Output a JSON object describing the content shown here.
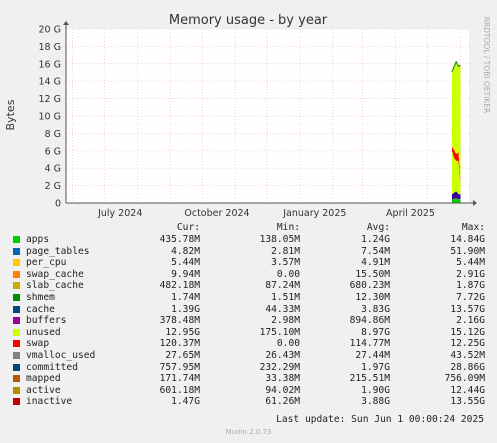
{
  "chart_data": {
    "type": "area",
    "title": "Memory usage - by year",
    "ylabel": "Bytes",
    "xlabel": "",
    "ylim": [
      0,
      20
    ],
    "y_unit": "G",
    "y_ticks": [
      "0",
      "2 G",
      "4 G",
      "6 G",
      "8 G",
      "10 G",
      "12 G",
      "14 G",
      "16 G",
      "18 G",
      "20 G"
    ],
    "x_ticks": [
      "July 2024",
      "October 2024",
      "January 2025",
      "April 2025"
    ],
    "grid": true,
    "x": [
      "2025-05-24",
      "2025-05-26",
      "2025-05-28",
      "2025-05-30",
      "2025-06-01"
    ],
    "series": [
      {
        "name": "apps",
        "color": "#00cc00",
        "values": [
          0.35,
          0.45,
          0.5,
          0.4,
          0.45
        ]
      },
      {
        "name": "page_tables",
        "color": "#0066b3",
        "values": [
          0.01,
          0.01,
          0.01,
          0.01,
          0.01
        ]
      },
      {
        "name": "per_cpu",
        "color": "#ff8000",
        "values": [
          0.01,
          0.01,
          0.01,
          0.01,
          0.01
        ]
      },
      {
        "name": "swap_cache",
        "color": "#ffcc00",
        "values": [
          0.01,
          0.01,
          0.01,
          0.01,
          0.01
        ]
      },
      {
        "name": "slab_cache",
        "color": "#330099",
        "values": [
          0.6,
          0.7,
          0.8,
          0.6,
          0.5
        ]
      },
      {
        "name": "shmem",
        "color": "#990099",
        "values": [
          0.01,
          0.01,
          0.01,
          0.01,
          0.01
        ]
      },
      {
        "name": "cache",
        "color": "#ccff00",
        "values": [
          5.0,
          4.0,
          3.5,
          3.8,
          1.4
        ]
      },
      {
        "name": "buffers",
        "color": "#ff0000",
        "values": [
          0.5,
          0.9,
          0.8,
          1.0,
          0.38
        ]
      },
      {
        "name": "unused",
        "color": "#ccff00",
        "values": [
          8.5,
          9.5,
          10.5,
          9.8,
          12.95
        ]
      },
      {
        "name": "swap",
        "color": "#ff0000",
        "values": [
          0.1,
          0.1,
          0.1,
          0.1,
          0.12
        ]
      }
    ],
    "legend": {
      "headers": [
        "Cur:",
        "Min:",
        "Avg:",
        "Max:"
      ],
      "rows": [
        {
          "name": "apps",
          "color": "#00cc00",
          "cur": "435.78M",
          "min": "138.05M",
          "avg": "1.24G",
          "max": "14.84G"
        },
        {
          "name": "page_tables",
          "color": "#0066b3",
          "cur": "4.82M",
          "min": "2.81M",
          "avg": "7.54M",
          "max": "51.90M"
        },
        {
          "name": "per_cpu",
          "color": "#ffcc00",
          "cur": "5.44M",
          "min": "3.57M",
          "avg": "4.91M",
          "max": "5.44M"
        },
        {
          "name": "swap_cache",
          "color": "#ff8000",
          "cur": "9.94M",
          "min": "0.00",
          "avg": "15.50M",
          "max": "2.91G"
        },
        {
          "name": "slab_cache",
          "color": "#ccaa00",
          "cur": "482.18M",
          "min": "87.24M",
          "avg": "680.23M",
          "max": "1.87G"
        },
        {
          "name": "shmem",
          "color": "#008f00",
          "cur": "1.74M",
          "min": "1.51M",
          "avg": "12.30M",
          "max": "7.72G"
        },
        {
          "name": "cache",
          "color": "#00487d",
          "cur": "1.39G",
          "min": "44.33M",
          "avg": "3.83G",
          "max": "13.57G"
        },
        {
          "name": "buffers",
          "color": "#990099",
          "cur": "378.48M",
          "min": "2.98M",
          "avg": "894.86M",
          "max": "2.16G"
        },
        {
          "name": "unused",
          "color": "#ccff00",
          "cur": "12.95G",
          "min": "175.10M",
          "avg": "8.97G",
          "max": "15.12G"
        },
        {
          "name": "swap",
          "color": "#ff0000",
          "cur": "120.37M",
          "min": "0.00",
          "avg": "114.77M",
          "max": "12.25G"
        },
        {
          "name": "vmalloc_used",
          "color": "#808080",
          "cur": "27.65M",
          "min": "26.43M",
          "avg": "27.44M",
          "max": "43.52M"
        },
        {
          "name": "committed",
          "color": "#00487d",
          "cur": "757.95M",
          "min": "232.29M",
          "avg": "1.97G",
          "max": "28.86G"
        },
        {
          "name": "mapped",
          "color": "#b35a00",
          "cur": "171.74M",
          "min": "33.38M",
          "avg": "215.51M",
          "max": "756.09M"
        },
        {
          "name": "active",
          "color": "#b38f00",
          "cur": "601.18M",
          "min": "94.02M",
          "avg": "1.90G",
          "max": "12.44G"
        },
        {
          "name": "inactive",
          "color": "#bf0000",
          "cur": "1.47G",
          "min": "61.26M",
          "avg": "3.88G",
          "max": "13.55G"
        }
      ]
    }
  },
  "side_label": "RRDTOOL / TOBI OETIKER",
  "last_update": "Last update: Sun Jun  1 00:00:24 2025",
  "footer": "Munin 2.0.73"
}
